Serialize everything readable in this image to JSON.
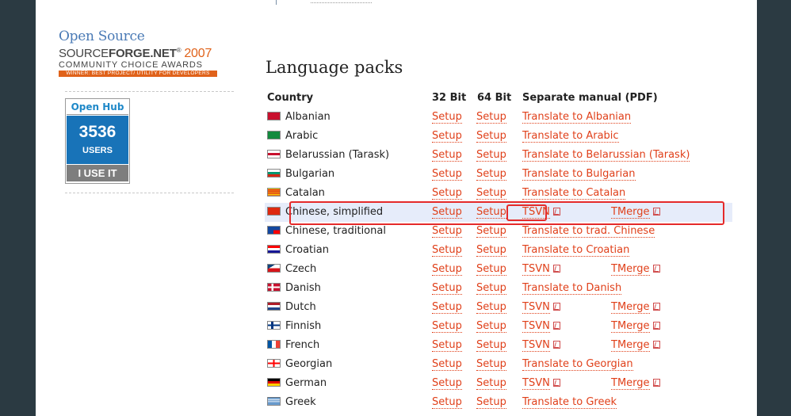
{
  "sidebar": {
    "award": {
      "open_source": "Open Source",
      "line1_a": "SOURCE",
      "line1_b": "FORGE.NET",
      "line1_reg": "®",
      "line1_year": "2007",
      "line2": "COMMUNITY CHOICE AWARDS",
      "line3": "WINNER: BEST PROJECT/ UTILITY FOR DEVELOPERS"
    },
    "openhub": {
      "title": "Open Hub",
      "count": "3536",
      "users": "USERS",
      "cta": "I USE IT"
    }
  },
  "main": {
    "title": "Language packs",
    "columns": {
      "country": "Country",
      "bit32": "32 Bit",
      "bit64": "64 Bit",
      "manual": "Separate manual (PDF)"
    },
    "rows": [
      {
        "flag": "flag-albanian",
        "country": "Albanian",
        "bit32": "Setup",
        "bit64": "Setup",
        "manual1": "Translate to Albanian",
        "manual2": ""
      },
      {
        "flag": "flag-arabic",
        "country": "Arabic",
        "bit32": "Setup",
        "bit64": "Setup",
        "manual1": "Translate to Arabic",
        "manual2": ""
      },
      {
        "flag": "flag-belarussian",
        "country": "Belarussian (Tarask)",
        "bit32": "Setup",
        "bit64": "Setup",
        "manual1": "Translate to Belarussian (Tarask)",
        "manual2": ""
      },
      {
        "flag": "flag-bulgarian",
        "country": "Bulgarian",
        "bit32": "Setup",
        "bit64": "Setup",
        "manual1": "Translate to Bulgarian",
        "manual2": ""
      },
      {
        "flag": "flag-catalan",
        "country": "Catalan",
        "bit32": "Setup",
        "bit64": "Setup",
        "manual1": "Translate to Catalan",
        "manual2": ""
      },
      {
        "flag": "flag-chinese-s",
        "country": "Chinese, simplified",
        "bit32": "Setup",
        "bit64": "Setup",
        "manual1": "TSVN",
        "manual2": "TMerge"
      },
      {
        "flag": "flag-chinese-t",
        "country": "Chinese, traditional",
        "bit32": "Setup",
        "bit64": "Setup",
        "manual1": "Translate to trad. Chinese",
        "manual2": ""
      },
      {
        "flag": "flag-croatian",
        "country": "Croatian",
        "bit32": "Setup",
        "bit64": "Setup",
        "manual1": "Translate to Croatian",
        "manual2": ""
      },
      {
        "flag": "flag-czech",
        "country": "Czech",
        "bit32": "Setup",
        "bit64": "Setup",
        "manual1": "TSVN",
        "manual2": "TMerge"
      },
      {
        "flag": "flag-danish",
        "country": "Danish",
        "bit32": "Setup",
        "bit64": "Setup",
        "manual1": "Translate to Danish",
        "manual2": ""
      },
      {
        "flag": "flag-dutch",
        "country": "Dutch",
        "bit32": "Setup",
        "bit64": "Setup",
        "manual1": "TSVN",
        "manual2": "TMerge"
      },
      {
        "flag": "flag-finnish",
        "country": "Finnish",
        "bit32": "Setup",
        "bit64": "Setup",
        "manual1": "TSVN",
        "manual2": "TMerge"
      },
      {
        "flag": "flag-french",
        "country": "French",
        "bit32": "Setup",
        "bit64": "Setup",
        "manual1": "TSVN",
        "manual2": "TMerge"
      },
      {
        "flag": "flag-georgian",
        "country": "Georgian",
        "bit32": "Setup",
        "bit64": "Setup",
        "manual1": "Translate to Georgian",
        "manual2": ""
      },
      {
        "flag": "flag-german",
        "country": "German",
        "bit32": "Setup",
        "bit64": "Setup",
        "manual1": "TSVN",
        "manual2": "TMerge"
      },
      {
        "flag": "flag-greek",
        "country": "Greek",
        "bit32": "Setup",
        "bit64": "Setup",
        "manual1": "Translate to Greek",
        "manual2": ""
      }
    ],
    "highlighted_row": 5
  },
  "colors": {
    "link": "#e0401a",
    "highlight_row": "#e6ecfa",
    "annotation": "#e52a2a",
    "frame": "#2b3a42"
  }
}
